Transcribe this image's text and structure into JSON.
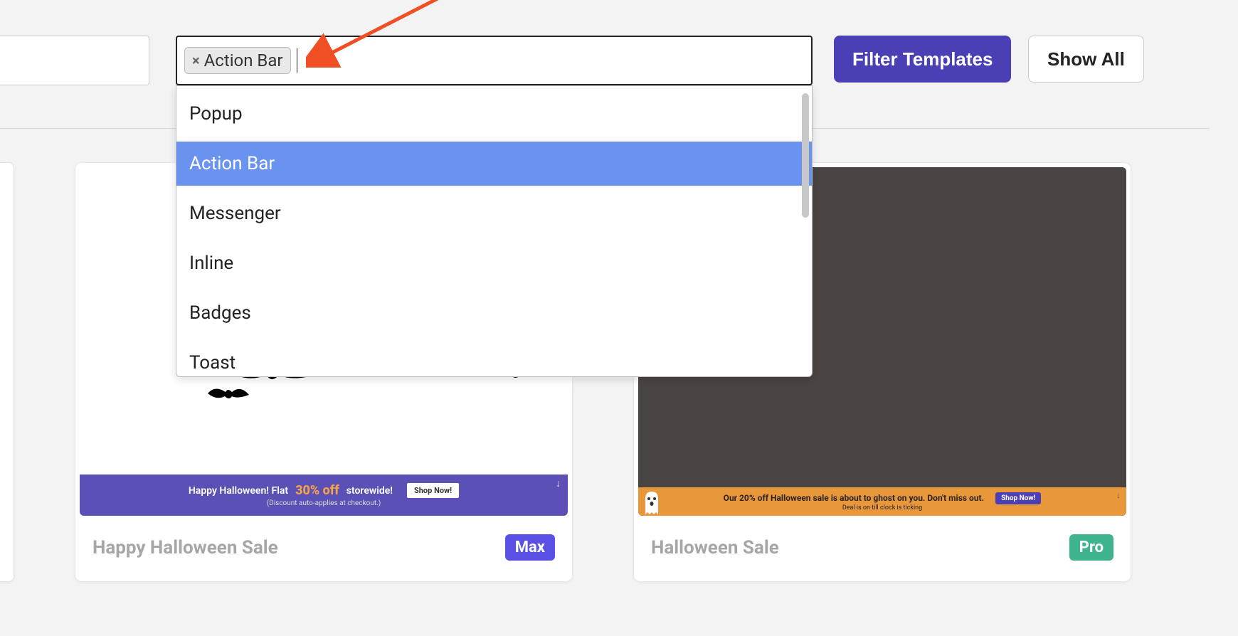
{
  "toolbar": {
    "chip_label": "Action Bar",
    "filter_button": "Filter Templates",
    "show_all_button": "Show All"
  },
  "dropdown": {
    "options": [
      "Popup",
      "Action Bar",
      "Messenger",
      "Inline",
      "Badges",
      "Toast"
    ],
    "selected_index": 1
  },
  "cards": [
    {
      "title": "Happy Halloween Sale",
      "tier": "Max",
      "banner": {
        "line1_prefix": "Happy Halloween! Flat",
        "highlight": "30% off",
        "line1_suffix": "storewide!",
        "button": "Shop Now!",
        "subtext": "(Discount auto-applies at checkout.)"
      }
    },
    {
      "title": "Halloween Sale",
      "tier": "Pro",
      "banner": {
        "line1": "Our 20% off Halloween sale is about to ghost on you. Don't miss out.",
        "button": "Shop Now!",
        "subtext": "Deal is on till clock is ticking"
      }
    }
  ],
  "colors": {
    "primary": "#4a3fb5",
    "dropdown_highlight": "#6a93f0",
    "badge_max": "#5a50e6",
    "badge_pro": "#3fb58f",
    "banner2_bg": "#e8983a",
    "annotation_arrow": "#f04e23"
  }
}
